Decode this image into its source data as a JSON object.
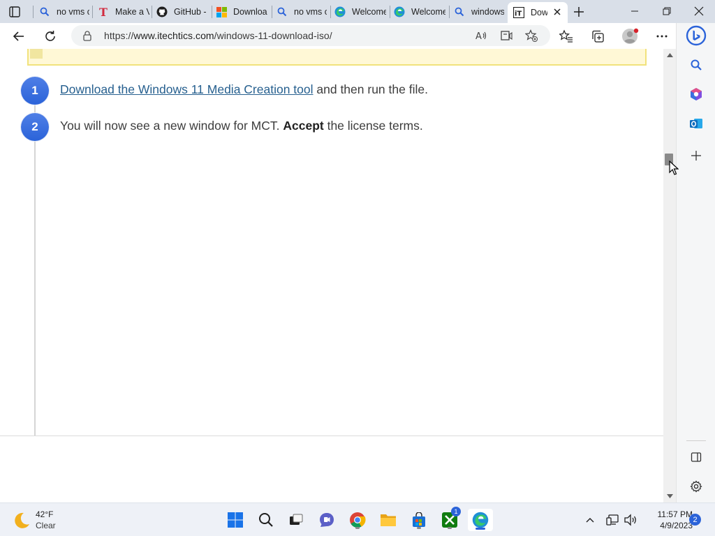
{
  "tabs": [
    {
      "title": "no vms c",
      "icon": "search-icon"
    },
    {
      "title": "Make a V",
      "icon": "t-logo-icon"
    },
    {
      "title": "GitHub -",
      "icon": "github-icon"
    },
    {
      "title": "Downloa",
      "icon": "microsoft-icon"
    },
    {
      "title": "no vms c",
      "icon": "search-icon"
    },
    {
      "title": "Welcome",
      "icon": "edge-icon"
    },
    {
      "title": "Welcome",
      "icon": "edge-icon"
    },
    {
      "title": "windows",
      "icon": "search-icon"
    },
    {
      "title": "Dow",
      "icon": "itechtics-icon",
      "active": true
    }
  ],
  "address": {
    "url_prefix": "https://",
    "url_host": "www.itechtics.com",
    "url_path": "/windows-11-download-iso/"
  },
  "steps": [
    {
      "num": "1",
      "link": "Download the Windows 11 Media Creation tool",
      "rest": " and then run the file."
    },
    {
      "num": "2",
      "pre": "You will now see a new window for MCT. ",
      "bold": "Accept",
      "post": " the license terms."
    }
  ],
  "weather": {
    "temp": "42°F",
    "cond": "Clear"
  },
  "clock": {
    "time": "11:57 PM",
    "date": "4/9/2023"
  },
  "badges": {
    "xbox": "1",
    "notifications": "2"
  },
  "colors": {
    "accent": "#2b63d9",
    "link": "#27608f",
    "note_bg": "#fff8d6",
    "note_border": "#f1e27c"
  }
}
